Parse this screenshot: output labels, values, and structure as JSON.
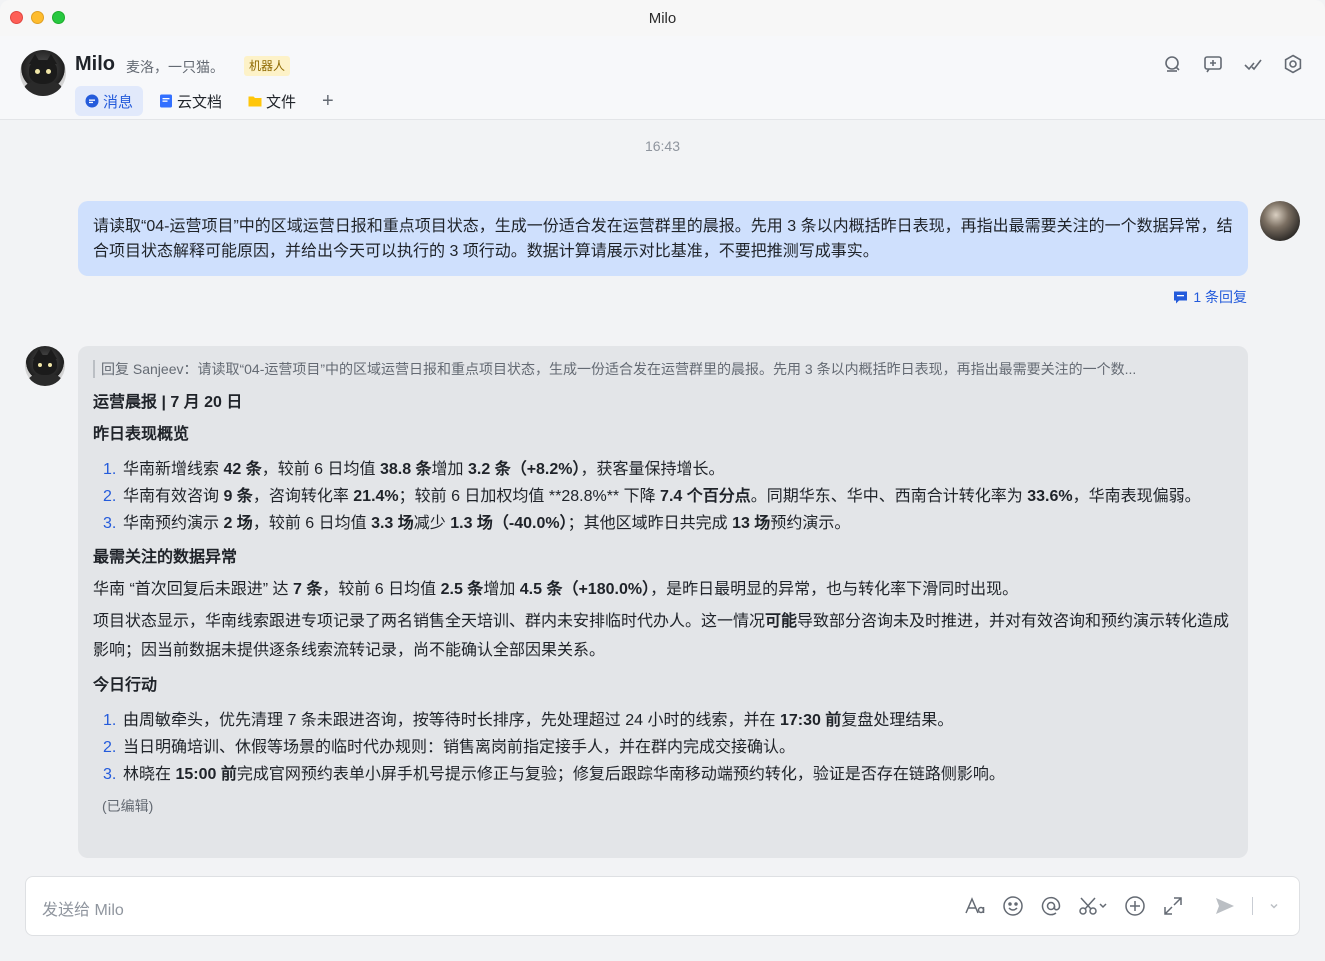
{
  "window": {
    "title": "Milo"
  },
  "header": {
    "name": "Milo",
    "description": "麦洛，一只猫。",
    "tag": "机器人",
    "tabs": [
      {
        "label": "消息",
        "icon": "chat-bubble-icon",
        "active": true
      },
      {
        "label": "云文档",
        "icon": "doc-icon",
        "active": false
      },
      {
        "label": "文件",
        "icon": "folder-icon",
        "active": false
      }
    ],
    "add_tab": "+",
    "actions": [
      "search-icon",
      "add-chat-icon",
      "mark-done-icon",
      "settings-icon"
    ]
  },
  "chat": {
    "timestamp": "16:43",
    "user_message": "请读取“04-运营项目”中的区域运营日报和重点项目状态，生成一份适合发在运营群里的晨报。先用 3 条以内概括昨日表现，再指出最需要关注的一个数据异常，结合项目状态解释可能原因，并给出今天可以执行的 3 项行动。数据计算请展示对比基准，不要把推测写成事实。",
    "reply_count": "1 条回复",
    "bot_reply": {
      "quote": "回复 Sanjeev：请读取“04-运营项目”中的区域运营日报和重点项目状态，生成一份适合发在运营群里的晨报。先用 3 条以内概括昨日表现，再指出最需要关注的一个数...",
      "title": "运营晨报 | 7 月 20 日",
      "section1": "昨日表现概览",
      "overview": [
        {
          "num": "1.",
          "html": "华南新增线索 <b>42 条</b>，较前 6 日均值 <b>38.8 条</b>增加 <b>3.2 条（+8.2%）</b>，获客量保持增长。"
        },
        {
          "num": "2.",
          "html": "华南有效咨询 <b>9 条</b>，咨询转化率 <b>21.4%</b>；较前 6 日加权均值 **28.8%** 下降 <b>7.4 个百分点</b>。同期华东、华中、西南合计转化率为 <b>33.6%</b>，华南表现偏弱。"
        },
        {
          "num": "3.",
          "html": "华南预约演示 <b>2 场</b>，较前 6 日均值 <b>3.3 场</b>减少 <b>1.3 场（-40.0%）</b>；其他区域昨日共完成 <b>13 场</b>预约演示。"
        }
      ],
      "section2": "最需关注的数据异常",
      "anomaly_p1": "华南 “首次回复后未跟进” 达 <b>7 条</b>，较前 6 日均值 <b>2.5 条</b>增加 <b>4.5 条（+180.0%）</b>，是昨日最明显的异常，也与转化率下滑同时出现。",
      "anomaly_p2": "项目状态显示，华南线索跟进专项记录了两名销售全天培训、群内未安排临时代办人。这一情况<b>可能</b>导致部分咨询未及时推进，并对有效咨询和预约演示转化造成影响；因当前数据未提供逐条线索流转记录，尚不能确认全部因果关系。",
      "section3": "今日行动",
      "actions": [
        {
          "num": "1.",
          "html": "由周敏牵头，优先清理 7 条未跟进咨询，按等待时长排序，先处理超过 24 小时的线索，并在 <b>17:30 前</b>复盘处理结果。"
        },
        {
          "num": "2.",
          "html": "当日明确培训、休假等场景的临时代办规则：销售离岗前指定接手人，并在群内完成交接确认。"
        },
        {
          "num": "3.",
          "html": "林晓在 <b>15:00 前</b>完成官网预约表单小屏手机号提示修正与复验；修复后跟踪华南移动端预约转化，验证是否存在链路侧影响。"
        }
      ],
      "edited": "(已编辑)"
    }
  },
  "composer": {
    "placeholder": "发送给 Milo",
    "tools": [
      "font-format-icon",
      "emoji-icon",
      "mention-icon",
      "scissors-icon",
      "add-circle-icon",
      "expand-icon",
      "send-icon",
      "chevron-down-icon"
    ]
  },
  "colors": {
    "accent": "#245bdb",
    "user_bubble": "#cfe0fd",
    "bot_bubble": "#e3e5e8",
    "tag_bg": "#fdf2c8"
  }
}
